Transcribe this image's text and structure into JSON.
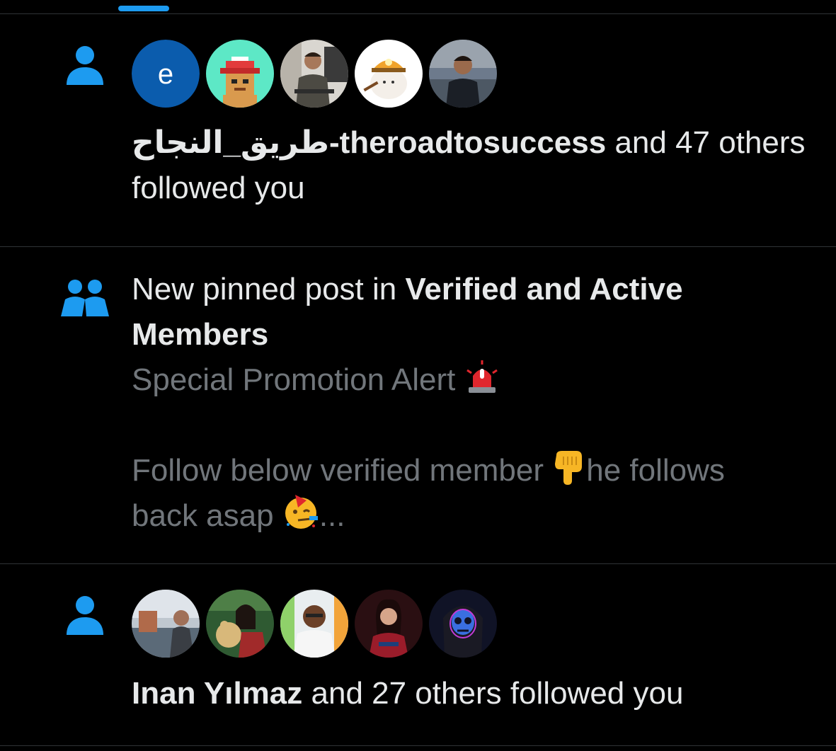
{
  "colors": {
    "accent": "#1d9bf0",
    "background": "#000000",
    "text_primary": "#e7e9ea",
    "text_secondary": "#71767b",
    "divider": "#2f3336"
  },
  "notifications": [
    {
      "type": "follow",
      "icon": "person-icon",
      "avatars": [
        "avatar-letter-e",
        "avatar-pixel-character",
        "avatar-man-office",
        "avatar-cartoon-miner",
        "avatar-man-stairs"
      ],
      "avatar_letter": "e",
      "actor": "طريق_النجاح-theroadtosuccess",
      "rest_line1": " and 47 others",
      "rest_line2": "followed you"
    },
    {
      "type": "pinned-post",
      "icon": "people-icon",
      "prefix": "New pinned post in ",
      "community_line1": "Verified and Active",
      "community_line2": "Members",
      "preview_line1": "Special Promotion Alert ",
      "preview_line2": "Follow below verified member ",
      "preview_line2b": "he follows",
      "preview_line3": "back asap ",
      "preview_ellipsis": "..."
    },
    {
      "type": "follow",
      "icon": "person-icon",
      "avatars": [
        "avatar-man-lake",
        "avatar-woman-teddy",
        "avatar-man-white-shirt",
        "avatar-woman-red",
        "avatar-skull-hood"
      ],
      "actor": "Inan Yılmaz",
      "rest": " and 27 others followed you"
    }
  ]
}
